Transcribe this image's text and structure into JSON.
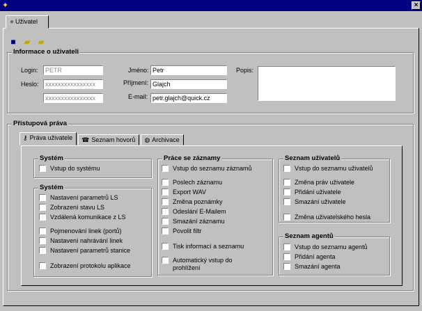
{
  "window": {
    "title": "",
    "close_glyph": "×"
  },
  "tab": {
    "label": "Uživatel"
  },
  "info": {
    "legend": "Informace o uživateli",
    "login_label": "Login:",
    "login_value": "PETR",
    "password_label": "Heslo:",
    "password_value": "xxxxxxxxxxxxxxxx",
    "password_confirm_value": "xxxxxxxxxxxxxxxx",
    "firstname_label": "Jméno:",
    "firstname_value": "Petr",
    "lastname_label": "Příjmení:",
    "lastname_value": "Glajch",
    "email_label": "E-mail:",
    "email_value": "petr.glajch@quick.cz",
    "description_label": "Popis:",
    "description_value": ""
  },
  "rights": {
    "legend": "Přístupová práva",
    "subtabs": [
      "Práva uživatele",
      "Seznam hovorů",
      "Archivace"
    ],
    "g1": {
      "legend": "Systém",
      "items": [
        "Vstup do systému"
      ]
    },
    "g2": {
      "legend": "Systém",
      "items": [
        "Nastavení parametrů LS",
        "Zobrazení stavu LS",
        "Vzdálená komunikace z LS",
        "Pojmenování linek (portů)",
        "Nastavení nahrávání linek",
        "Nastavení parametrů stanice",
        "Zobrazení protokolu aplikace"
      ]
    },
    "g3": {
      "legend": "Práce se záznamy",
      "items": [
        "Vstup do seznamu záznamů",
        "Poslech záznamu",
        "Export WAV",
        "Změna poznámky",
        "Odeslání E-Mailem",
        "Smazání záznamu",
        "Povolit filtr",
        "Tisk informací a seznamu",
        "Automatický vstup do\nprohlížení"
      ]
    },
    "g4": {
      "legend": "Seznam uživatelů",
      "items": [
        "Vstup do seznamu uživatelů",
        "Změna práv uživatele",
        "Přidání uživatele",
        "Smazání uživatele",
        "Změna uživatelského hesla"
      ]
    },
    "g5": {
      "legend": "Seznam agentů",
      "items": [
        "Vstup do seznamu agentů",
        "Přidání agenta",
        "Smazání agenta"
      ]
    }
  }
}
